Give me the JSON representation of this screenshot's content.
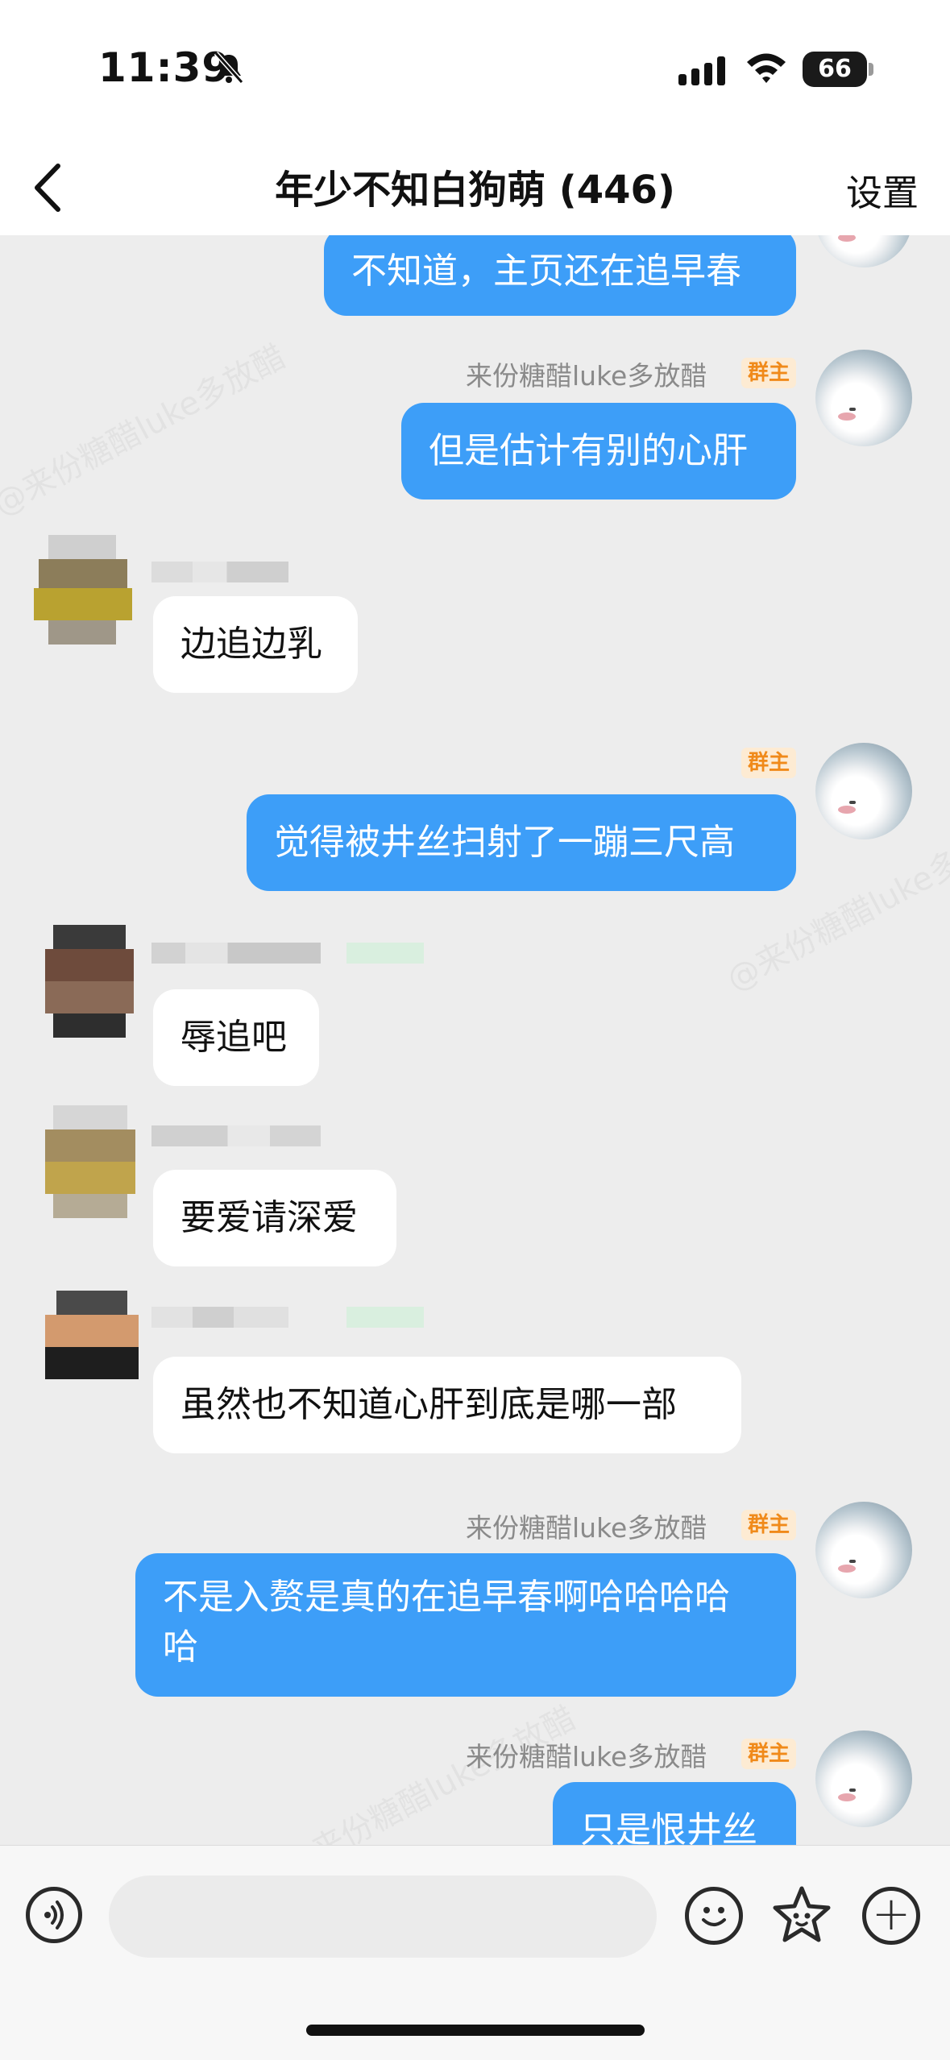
{
  "status": {
    "time": "11:39",
    "battery": "66"
  },
  "nav": {
    "title": "年少不知白狗萌 (446)",
    "settings": "设置"
  },
  "messages": [
    {
      "side": "me",
      "text": "不知道，主页还在追早春"
    },
    {
      "side": "me",
      "name": "来份糖醋luke多放醋",
      "badge": "群主",
      "text": "但是估计有别的心肝"
    },
    {
      "side": "them",
      "text": "边追边乳"
    },
    {
      "side": "me",
      "badge": "群主",
      "text": "觉得被井丝扫射了一蹦三尺高"
    },
    {
      "side": "them",
      "text": "辱追吧"
    },
    {
      "side": "them",
      "text": "要爱请深爱"
    },
    {
      "side": "them",
      "text": "虽然也不知道心肝到底是哪一部"
    },
    {
      "side": "me",
      "name": "来份糖醋luke多放醋",
      "badge": "群主",
      "text": "不是入赘是真的在追早春啊哈哈哈哈哈"
    },
    {
      "side": "me",
      "name": "来份糖醋luke多放醋",
      "badge": "群主",
      "text": "只是恨井丝"
    }
  ],
  "watermark": "@来份糖醋luke多放醋",
  "input": {
    "placeholder": ""
  },
  "colors": {
    "my_bubble": "#3d9ef8",
    "their_bubble": "#ffffff",
    "badge_bg": "#fdebd3",
    "badge_text": "#f08a1a"
  },
  "icons": [
    "bell-slash-icon",
    "signal-icon",
    "wifi-icon",
    "battery-icon",
    "back-chevron-icon",
    "voice-icon",
    "emoji-icon",
    "sticker-icon",
    "plus-icon"
  ]
}
